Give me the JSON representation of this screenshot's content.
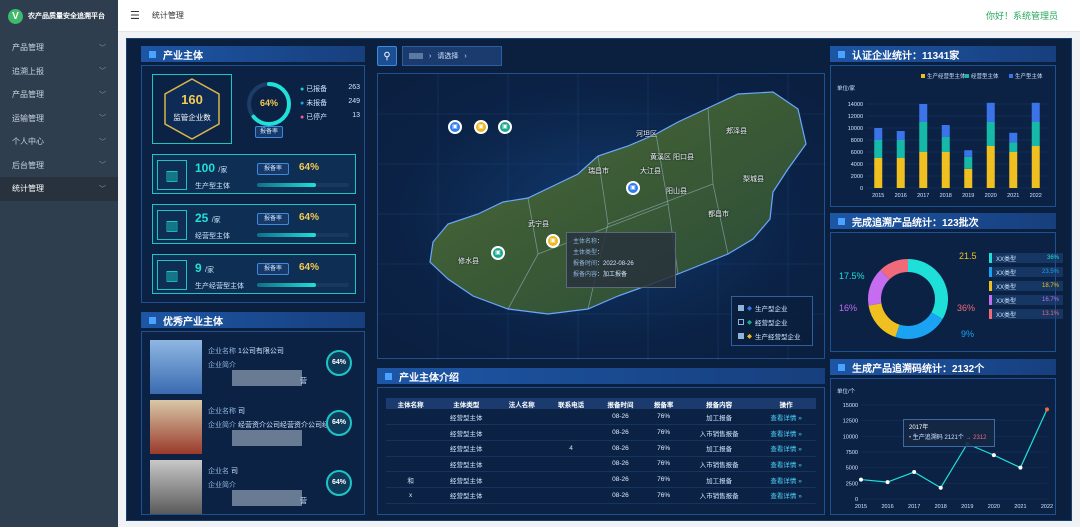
{
  "app": {
    "logo_letter": "V",
    "name": "农产品质量安全追溯平台"
  },
  "sidebar": {
    "items": [
      {
        "label": "产品管理"
      },
      {
        "label": "追溯上报"
      },
      {
        "label": "产品管理"
      },
      {
        "label": "运输管理"
      },
      {
        "label": "个人中心"
      },
      {
        "label": "后台管理"
      },
      {
        "label": "统计管理"
      }
    ]
  },
  "topbar": {
    "breadcrumb": "统计管理",
    "greeting": "你好！系统管理员"
  },
  "subjects": {
    "title": "产业主体",
    "total": "160",
    "total_label": "监管企业数",
    "gauge_value": "64%",
    "gauge_label": "报备率",
    "status": [
      {
        "label": "已报备",
        "value": "263",
        "color": "#1ad1d1"
      },
      {
        "label": "未报备",
        "value": "249",
        "color": "#1aa3f2"
      },
      {
        "label": "已停产",
        "value": "13",
        "color": "#f25a9b"
      }
    ],
    "types": [
      {
        "count": "100",
        "unit": "/家",
        "name": "生产型主体",
        "rate_label": "报备率",
        "rate": "64%",
        "fill": 0.64
      },
      {
        "count": "25",
        "unit": "/家",
        "name": "经营型主体",
        "rate_label": "报备率",
        "rate": "64%",
        "fill": 0.64
      },
      {
        "count": "9",
        "unit": "/家",
        "name": "生产经营型主体",
        "rate_label": "报备率",
        "rate": "64%",
        "fill": 0.64
      }
    ]
  },
  "excellent": {
    "title": "优秀产业主体",
    "items": [
      {
        "line1": "企业名称",
        "line1b": "1公司有限公司",
        "line2": "企业简介",
        "line2b": "",
        "suffix": "营",
        "pct": "64%"
      },
      {
        "line1": "企业名称",
        "line1b": "司",
        "line2": "企业简介",
        "line2b": "经营资介公司经营资介公司经营",
        "suffix": "",
        "pct": "64%"
      },
      {
        "line1": "企业名",
        "line1b": "司",
        "line2": "企业简介",
        "line2b": "",
        "suffix": "营",
        "pct": "64%"
      }
    ]
  },
  "map": {
    "selector_sep": "›",
    "selector_placeholder": "请选择",
    "regions": [
      "河坦区",
      "郏泽县",
      "梨城县",
      "黄溪区",
      "阳口县",
      "大江县",
      "瑞昌市",
      "阳山县",
      "武宁县",
      "都昌市",
      "修水县"
    ],
    "popup": {
      "rows": [
        {
          "label": "主体名称",
          "value": ""
        },
        {
          "label": "主体类型",
          "value": ""
        },
        {
          "label": "报备时间",
          "value": "2022-08-26"
        },
        {
          "label": "报备内容",
          "value": "加工报备"
        }
      ]
    },
    "legend": [
      {
        "label": "生产型企业",
        "checked": true
      },
      {
        "label": "经营型企业",
        "checked": false
      },
      {
        "label": "生产经营型企业",
        "checked": true
      }
    ]
  },
  "intro": {
    "title": "产业主体介绍",
    "headers": [
      "主体名称",
      "主体类型",
      "法人名称",
      "联系电话",
      "报备时间",
      "报备率",
      "报备内容",
      "操作"
    ],
    "rows": [
      {
        "name": "",
        "type": "经营型主体",
        "legal": "",
        "phone": "",
        "time": "08-26",
        "rate": "76%",
        "content": "加工报备",
        "op": "查看详情"
      },
      {
        "name": "",
        "type": "经营型主体",
        "legal": "",
        "phone": "",
        "time": "08-26",
        "rate": "76%",
        "content": "入市销售报备",
        "op": "查看详情"
      },
      {
        "name": "",
        "type": "经营型主体",
        "legal": "",
        "phone": "4",
        "time": "08-26",
        "rate": "76%",
        "content": "加工报备",
        "op": "查看详情"
      },
      {
        "name": "",
        "type": "经营型主体",
        "legal": "",
        "phone": "",
        "time": "08-26",
        "rate": "76%",
        "content": "入市销售报备",
        "op": "查看详情"
      },
      {
        "name": "和",
        "type": "经营型主体",
        "legal": "",
        "phone": "",
        "time": "08-26",
        "rate": "76%",
        "content": "加工报备",
        "op": "查看详情"
      },
      {
        "name": "x",
        "type": "经营型主体",
        "legal": "",
        "phone": "",
        "time": "08-26",
        "rate": "76%",
        "content": "入市销售报备",
        "op": "查看详情"
      }
    ]
  },
  "cert": {
    "title": "认证企业统计：11341家",
    "unit_label": "单位/家"
  },
  "done": {
    "title": "完成追溯产品统计：123批次"
  },
  "codes": {
    "title": "生成产品追溯码统计：2132个",
    "unit_label": "单位/个",
    "tooltip": {
      "year": "2017年",
      "label": "生产追溯码",
      "value": "2121个",
      "delta": "2312"
    }
  },
  "chart_data": [
    {
      "type": "bar",
      "title": "认证企业统计：11341家",
      "ylabel": "单位/家",
      "stacked": true,
      "categories": [
        "2015",
        "2016",
        "2017",
        "2018",
        "2019",
        "2020",
        "2021",
        "2022"
      ],
      "ylim": [
        0,
        15000
      ],
      "yticks": [
        0,
        2000,
        4000,
        6000,
        8000,
        10000,
        12000,
        14000
      ],
      "series": [
        {
          "name": "生产经营型主体",
          "color": "#f0c020",
          "values": [
            5000,
            5000,
            6000,
            6000,
            3200,
            7000,
            6000,
            7000
          ]
        },
        {
          "name": "经营型主体",
          "color": "#16b9a7",
          "values": [
            3000,
            3000,
            5000,
            2500,
            2000,
            4000,
            1600,
            4000
          ]
        },
        {
          "name": "生产型主体",
          "color": "#3a74e8",
          "values": [
            2000,
            1500,
            3000,
            2000,
            1100,
            3200,
            1600,
            3200
          ]
        }
      ]
    },
    {
      "type": "pie",
      "title": "完成追溯产品统计：123批次",
      "donut": true,
      "labels": [
        "XX类型",
        "XX类型",
        "XX类型",
        "XX类型",
        "XX类型"
      ],
      "values": [
        36,
        23.5,
        18.7,
        16.7,
        13.1
      ],
      "colors": [
        "#1ee0d8",
        "#1aa3f2",
        "#f0c020",
        "#c56cf0",
        "#f06a7c"
      ],
      "callouts": [
        "21.5",
        "17.5%",
        "16%",
        "9%",
        "36%"
      ],
      "legend_values": [
        "36%",
        "23.5%",
        "18.7%",
        "16.7%",
        "13.1%"
      ]
    },
    {
      "type": "line",
      "title": "生成产品追溯码统计：2132个",
      "ylabel": "单位/个",
      "x": [
        "2015",
        "2016",
        "2017",
        "2018",
        "2019",
        "2020",
        "2021",
        "2022"
      ],
      "ylim": [
        0,
        15000
      ],
      "yticks": [
        0,
        2500,
        5000,
        7500,
        10000,
        12500,
        15000
      ],
      "series": [
        {
          "name": "生产追溯码",
          "values": [
            3100,
            2700,
            4300,
            1800,
            8800,
            7000,
            5000,
            14300
          ]
        }
      ]
    }
  ]
}
